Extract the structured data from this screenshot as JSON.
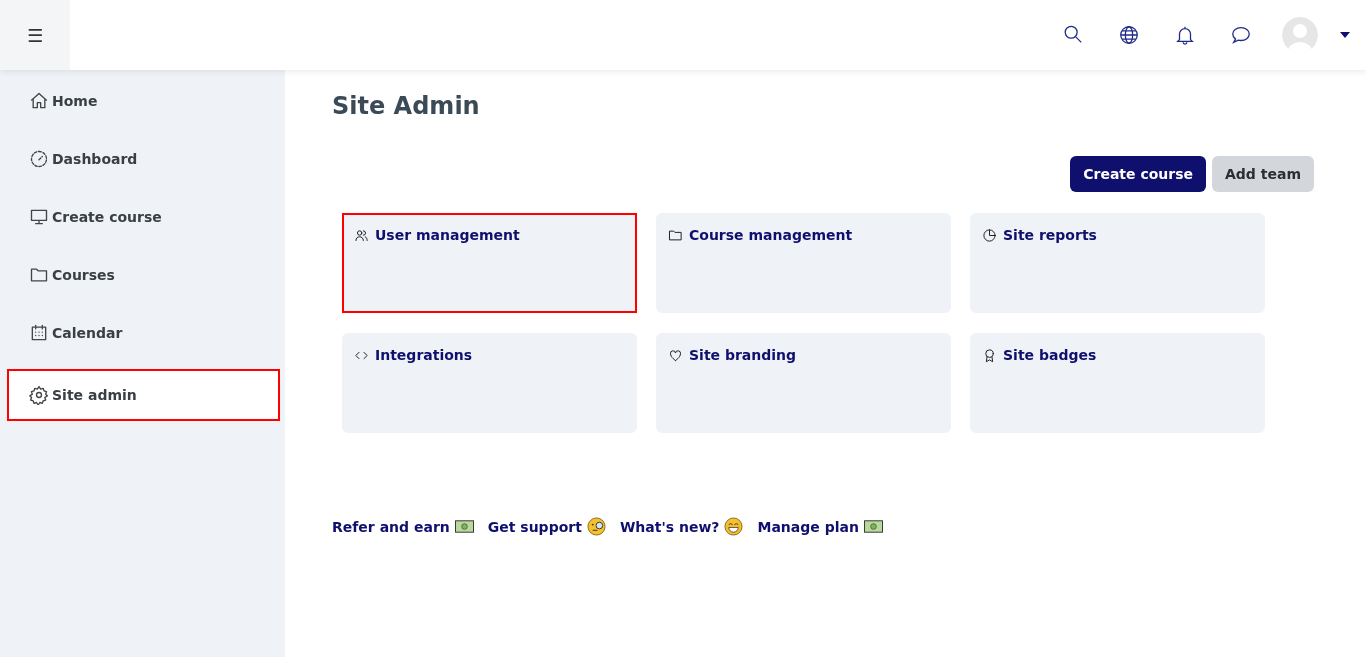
{
  "header": {
    "menu_icon": "☰"
  },
  "sidebar": {
    "items": [
      {
        "label": "Home",
        "selected": false,
        "highlighted": false
      },
      {
        "label": "Dashboard",
        "selected": false,
        "highlighted": false
      },
      {
        "label": "Create course",
        "selected": false,
        "highlighted": false
      },
      {
        "label": "Courses",
        "selected": false,
        "highlighted": false
      },
      {
        "label": "Calendar",
        "selected": false,
        "highlighted": false
      },
      {
        "label": "Site admin",
        "selected": true,
        "highlighted": true
      }
    ]
  },
  "page": {
    "title": "Site Admin",
    "buttons": [
      {
        "label": "Create course",
        "kind": "primary"
      },
      {
        "label": "Add team",
        "kind": "secondary"
      }
    ],
    "cards": [
      {
        "title": "User management",
        "highlighted": true
      },
      {
        "title": "Course management",
        "highlighted": false
      },
      {
        "title": "Site reports",
        "highlighted": false
      },
      {
        "title": "Integrations",
        "highlighted": false
      },
      {
        "title": "Site branding",
        "highlighted": false
      },
      {
        "title": "Site badges",
        "highlighted": false
      }
    ],
    "links": [
      {
        "label": "Refer and earn"
      },
      {
        "label": "Get support"
      },
      {
        "label": "What's new?"
      },
      {
        "label": "Manage plan"
      }
    ]
  }
}
